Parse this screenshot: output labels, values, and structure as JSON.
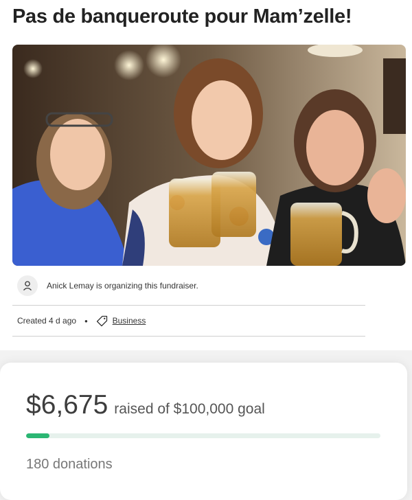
{
  "campaign": {
    "title": "Pas de banqueroute pour Mam’zelle!",
    "organizer_text": "Anick Lemay is organizing this fundraiser.",
    "created": "Created 4 d ago",
    "separator": "•",
    "category": "Business"
  },
  "funding": {
    "amount": "$6,675",
    "goal_text": "raised of $100,000 goal",
    "progress_fraction": 0.06675,
    "donations": "180 donations"
  },
  "icons": {
    "organizer": "user-icon",
    "category": "tag-icon"
  },
  "colors": {
    "progress": "#2bb673",
    "progress_track": "#e6f1ec"
  }
}
